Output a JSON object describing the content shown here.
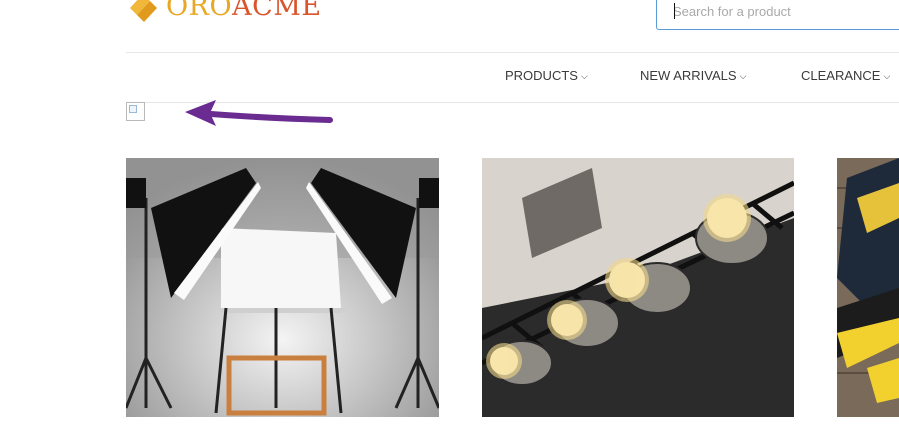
{
  "header": {
    "logo": {
      "part1": "ORO",
      "part2": "ACME"
    },
    "search": {
      "placeholder": "Search for a product",
      "value": ""
    }
  },
  "nav": {
    "items": [
      {
        "label": "PRODUCTS",
        "icon": "chevron-down-icon"
      },
      {
        "label": "NEW ARRIVALS",
        "icon": "chevron-down-icon"
      },
      {
        "label": "CLEARANCE",
        "icon": "chevron-down-icon"
      }
    ]
  },
  "content": {
    "broken_image_icon": "broken-image-icon",
    "annotation_arrow_color": "#6a2c91",
    "product_images": [
      {
        "subject": "photo studio softbox lights"
      },
      {
        "subject": "stage spotlights on truss"
      },
      {
        "subject": "yellow and black safety boots"
      }
    ]
  },
  "colors": {
    "logo_oro": "#e9a722",
    "logo_acme": "#d9542b",
    "search_border": "#5b9bd5",
    "nav_text": "#3a3a3a",
    "arrow": "#6a2c91"
  }
}
